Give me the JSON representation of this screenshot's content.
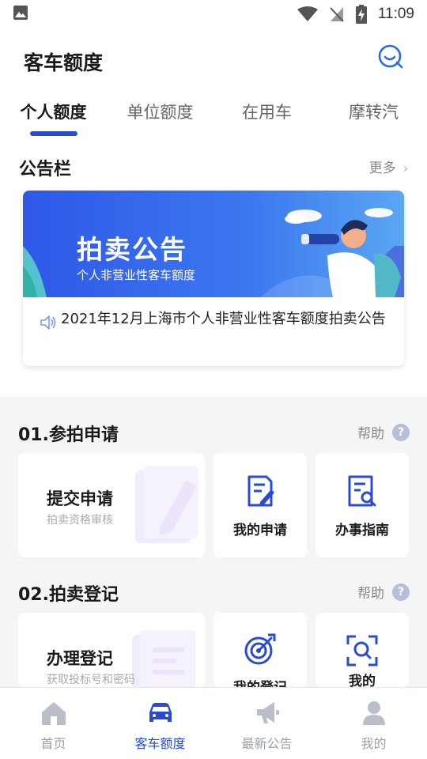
{
  "status_bar": {
    "time": "11:09"
  },
  "header": {
    "title": "客车额度",
    "tabs": [
      {
        "label": "个人额度",
        "active": true
      },
      {
        "label": "单位额度",
        "active": false
      },
      {
        "label": "在用车",
        "active": false
      },
      {
        "label": "摩转汽",
        "active": false
      }
    ]
  },
  "notice": {
    "title": "公告栏",
    "more": "更多",
    "banner_title": "拍卖公告",
    "banner_subtitle": "个人非营业性客车额度",
    "text": "2021年12月上海市个人非营业性客车额度拍卖公告"
  },
  "step1": {
    "title": "01.参拍申请",
    "help": "帮助",
    "main_card": {
      "title": "提交申请",
      "subtitle": "拍卖资格审核"
    },
    "cards": [
      {
        "label": "我的申请",
        "icon": "document-edit-icon"
      },
      {
        "label": "办事指南",
        "icon": "document-search-icon"
      }
    ]
  },
  "step2": {
    "title": "02.拍卖登记",
    "help": "帮助",
    "main_card": {
      "title": "办理登记",
      "subtitle": "获取投标号和密码"
    },
    "cards": [
      {
        "label": "我的登记",
        "icon": "target-icon"
      },
      {
        "label": "我的",
        "icon": "scan-search-icon"
      }
    ]
  },
  "bottom_nav": [
    {
      "label": "首页",
      "icon": "home-icon",
      "active": false
    },
    {
      "label": "客车额度",
      "icon": "car-icon",
      "active": true
    },
    {
      "label": "最新公告",
      "icon": "megaphone-icon",
      "active": false
    },
    {
      "label": "我的",
      "icon": "user-icon",
      "active": false
    }
  ],
  "colors": {
    "accent": "#2a4bd1",
    "banner": "#3565ea",
    "inactive": "#9aa0aa"
  }
}
